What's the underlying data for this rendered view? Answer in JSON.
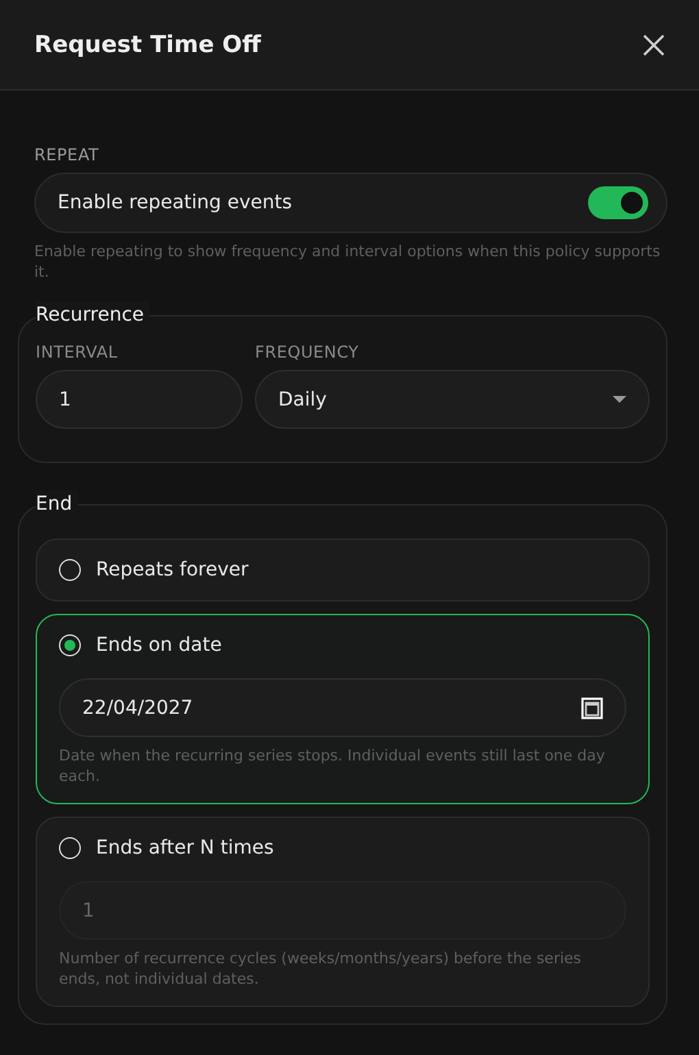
{
  "dialog": {
    "title": "Request Time Off"
  },
  "repeat": {
    "label": "REPEAT",
    "toggle_label": "Enable repeating events",
    "on": true,
    "hint": "Enable repeating to show frequency and interval options when this policy supports it."
  },
  "recurrence": {
    "legend": "Recurrence",
    "interval": {
      "label": "INTERVAL",
      "value": "1"
    },
    "frequency": {
      "label": "FREQUENCY",
      "value": "Daily"
    }
  },
  "end": {
    "legend": "End",
    "options": [
      {
        "label": "Repeats forever",
        "selected": false
      },
      {
        "label": "Ends on date",
        "selected": true,
        "field": {
          "kind": "date",
          "value": "22/04/2027",
          "disabled": false
        },
        "hint": "Date when the recurring series stops. Individual events still last one day each."
      },
      {
        "label": "Ends after N times",
        "selected": false,
        "field": {
          "kind": "number",
          "value": "1",
          "disabled": true
        },
        "hint": "Number of recurrence cycles (weeks/months/years) before the series ends, not individual dates."
      }
    ]
  }
}
